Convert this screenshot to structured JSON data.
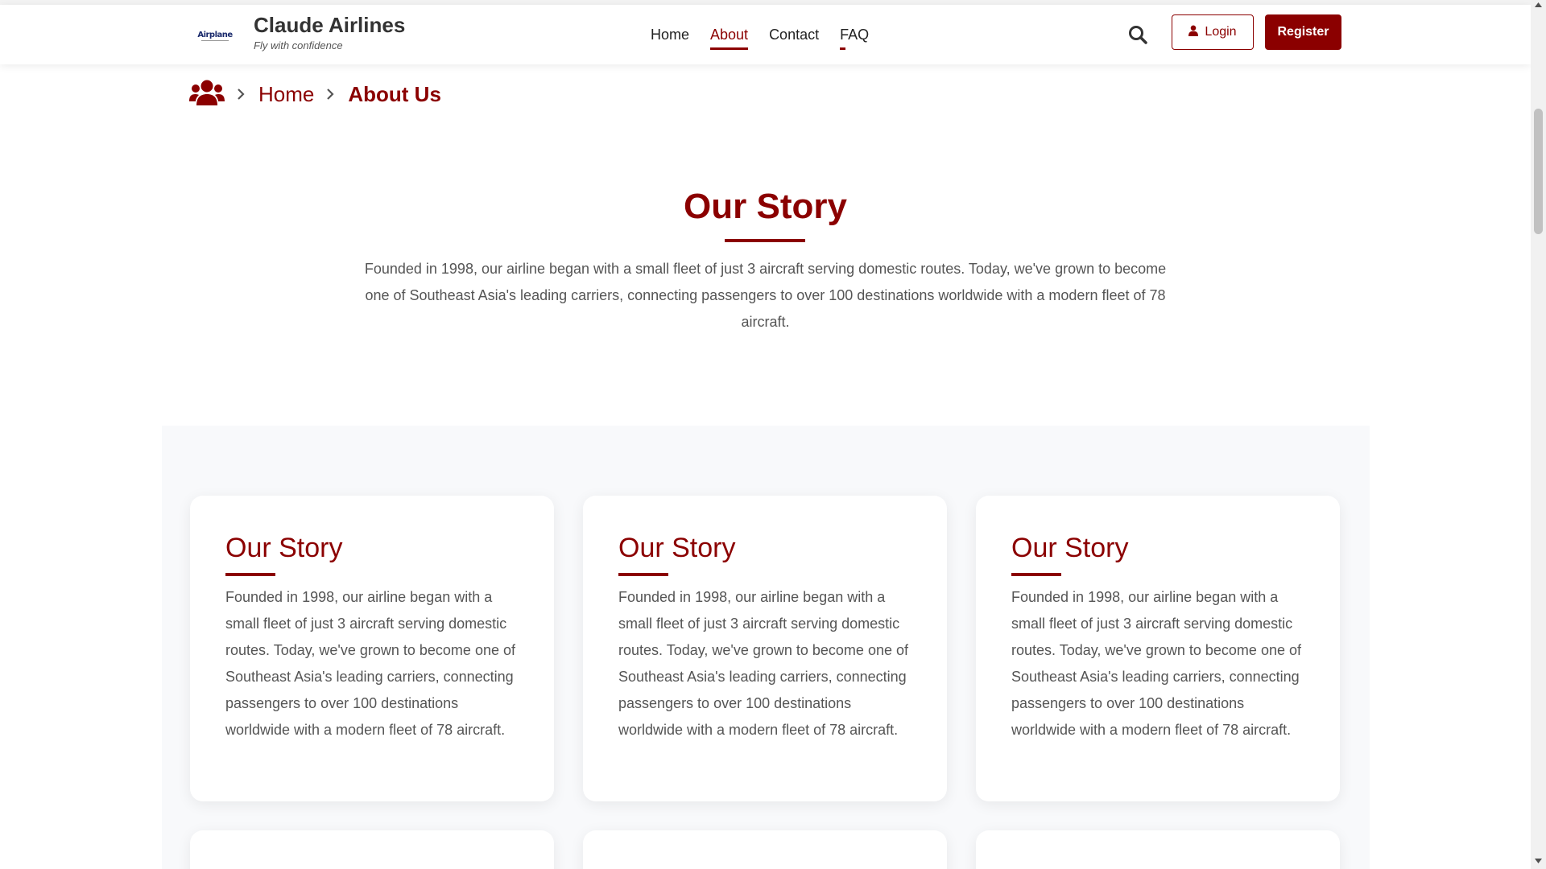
{
  "header": {
    "logo_text": "Airplane",
    "brand_name": "Claude Airlines",
    "tagline": "Fly with confidence",
    "nav": [
      {
        "label": "Home"
      },
      {
        "label": "About"
      },
      {
        "label": "Contact"
      },
      {
        "label": "FAQ"
      }
    ],
    "login_label": "Login",
    "register_label": "Register"
  },
  "breadcrumb": {
    "items": [
      "Home",
      "About Us"
    ]
  },
  "hero": {
    "title": "Our Story",
    "text": "Founded in 1998, our airline began with a small fleet of just 3 aircraft serving domestic routes. Today, we've grown to become one of Southeast Asia's leading carriers, connecting passengers to over 100 destinations worldwide with a modern fleet of 78 aircraft."
  },
  "cards": [
    {
      "title": "Our Story",
      "text": "Founded in 1998, our airline began with a small fleet of just 3 aircraft serving domestic routes. Today, we've grown to become one of Southeast Asia's leading carriers, connecting passengers to over 100 destinations worldwide with a modern fleet of 78 aircraft."
    },
    {
      "title": "Our Story",
      "text": "Founded in 1998, our airline began with a small fleet of just 3 aircraft serving domestic routes. Today, we've grown to become one of Southeast Asia's leading carriers, connecting passengers to over 100 destinations worldwide with a modern fleet of 78 aircraft."
    },
    {
      "title": "Our Story",
      "text": "Founded in 1998, our airline began with a small fleet of just 3 aircraft serving domestic routes. Today, we've grown to become one of Southeast Asia's leading carriers, connecting passengers to over 100 destinations worldwide with a modern fleet of 78 aircraft."
    }
  ],
  "colors": {
    "accent": "#8b0000",
    "text": "#555555",
    "section_bg": "#f8f9fb"
  },
  "icons": {
    "breadcrumb_root": "users-icon",
    "separator": "chevron-right-icon",
    "search": "search-icon",
    "login": "user-icon"
  }
}
